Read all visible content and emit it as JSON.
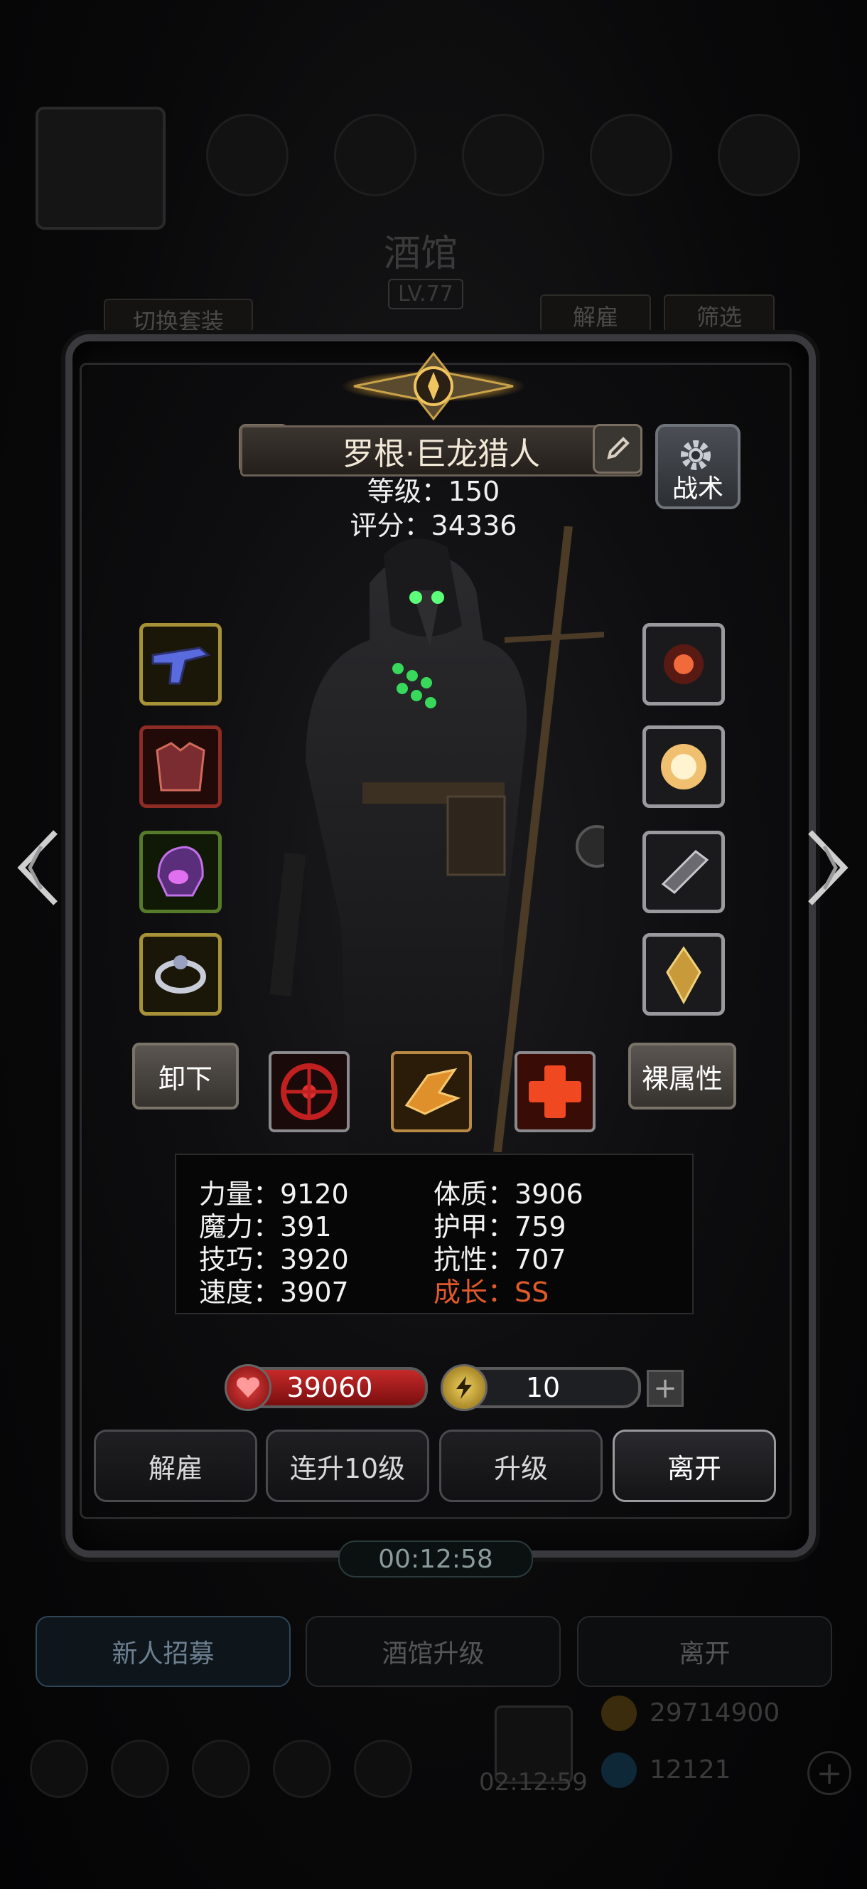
{
  "background": {
    "tavern_title": "酒馆",
    "tavern_level": "LV.77",
    "switch_outfit": "切换套装",
    "dismiss": "解雇",
    "filter": "筛选",
    "bottom_buttons": [
      "新人招募",
      "酒馆升级",
      "离开"
    ],
    "gold_amount": "29714900",
    "gem_amount": "12121",
    "chest_timer": "02:12:59"
  },
  "hero": {
    "name": "罗根·巨龙猎人",
    "level_line": "等级：150",
    "score_line": "评分：34336",
    "tactics_label": "战术"
  },
  "equipment": {
    "left": [
      {
        "name": "pistol",
        "rarity": "gold"
      },
      {
        "name": "red-armor",
        "rarity": "red"
      },
      {
        "name": "purple-helm",
        "rarity": "green"
      },
      {
        "name": "silver-ring",
        "rarity": "gold"
      }
    ],
    "right": [
      {
        "name": "fire-amulet",
        "rarity": "silver"
      },
      {
        "name": "light-orb",
        "rarity": "silver"
      },
      {
        "name": "gauntlet",
        "rarity": "silver"
      },
      {
        "name": "gold-pendant",
        "rarity": "silver"
      }
    ]
  },
  "actions": {
    "unequip": "卸下",
    "base_attributes": "裸属性"
  },
  "stats": {
    "strength": "力量：9120",
    "magic": "魔力：391",
    "skill": "技巧：3920",
    "speed": "速度：3907",
    "constitution": "体质：3906",
    "armor": "护甲：759",
    "resistance": "抗性：707",
    "growth": "成长：SS"
  },
  "resources": {
    "hp": "39060",
    "energy": "10",
    "energy_fill": 0.12
  },
  "buttons": {
    "dismiss": "解雇",
    "upgrade10": "连升10级",
    "upgrade": "升级",
    "leave": "离开"
  },
  "timer": "00:12:58",
  "colors": {
    "growth": "#e05a2a",
    "hp_bar": "#c62a2a",
    "energy_fill": "#c9b238"
  }
}
